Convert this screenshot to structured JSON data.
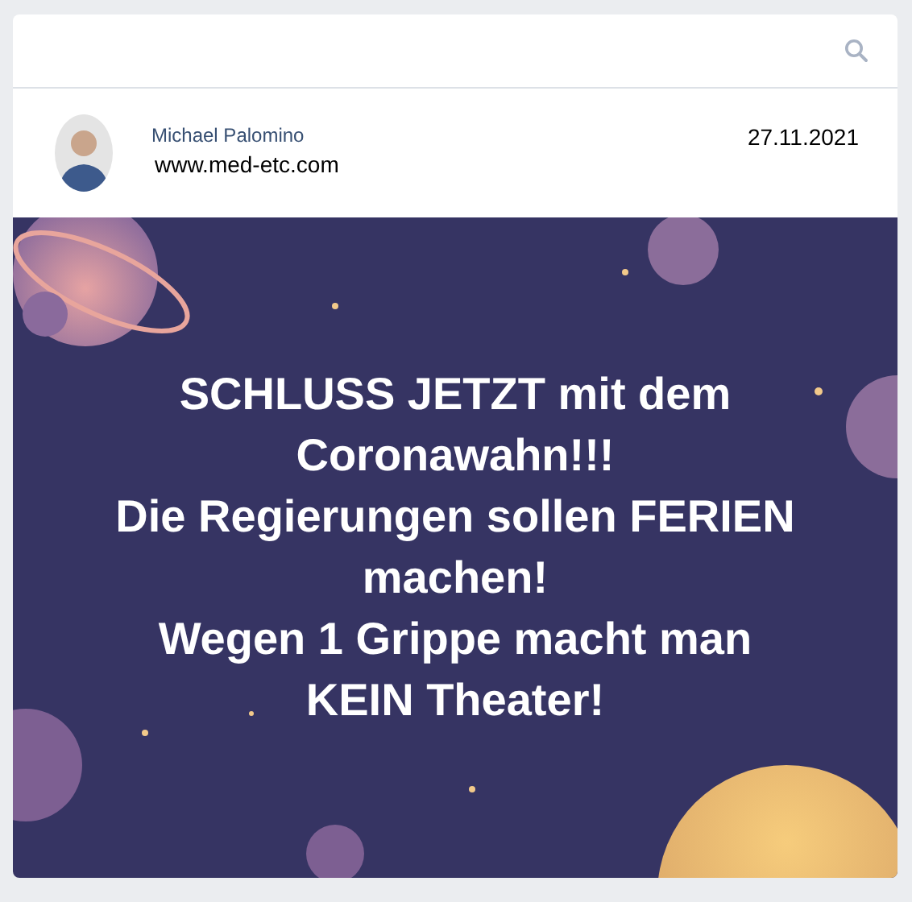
{
  "post": {
    "author": "Michael Palomino",
    "website": "www.med-etc.com",
    "date": "27.11.2021",
    "image": {
      "kind": "picture",
      "lines": [
        "SCHLUSS JETZT mit dem",
        "Coronawahn!!!",
        "Die Regierungen sollen FERIEN",
        "machen!",
        "Wegen 1 Grippe macht man",
        "KEIN Theater!"
      ]
    }
  }
}
